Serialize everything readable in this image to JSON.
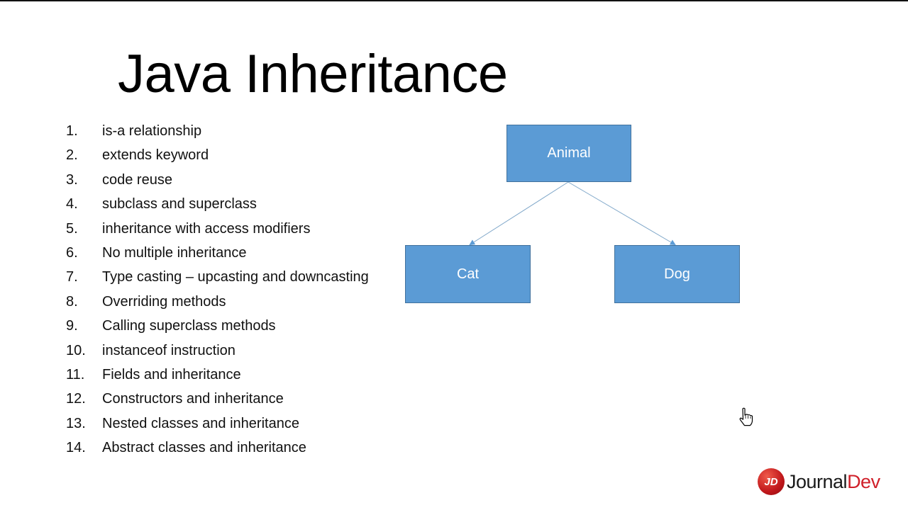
{
  "slide": {
    "title": "Java Inheritance",
    "topics": [
      {
        "num": "1.",
        "text": "is-a relationship"
      },
      {
        "num": "2.",
        "text": "extends keyword"
      },
      {
        "num": "3.",
        "text": "code reuse"
      },
      {
        "num": "4.",
        "text": "subclass and superclass"
      },
      {
        "num": "5.",
        "text": "inheritance with access modifiers"
      },
      {
        "num": "6.",
        "text": "No multiple inheritance"
      },
      {
        "num": "7.",
        "text": "Type casting – upcasting and downcasting"
      },
      {
        "num": "8.",
        "text": "Overriding methods"
      },
      {
        "num": "9.",
        "text": "Calling superclass methods"
      },
      {
        "num": "10.",
        "text": "instanceof instruction"
      },
      {
        "num": "11.",
        "text": "Fields and inheritance"
      },
      {
        "num": "12.",
        "text": "Constructors and inheritance"
      },
      {
        "num": "13.",
        "text": "Nested classes and inheritance"
      },
      {
        "num": "14.",
        "text": "Abstract classes and inheritance"
      }
    ]
  },
  "diagram": {
    "nodes": {
      "parent": "Animal",
      "child_left": "Cat",
      "child_right": "Dog"
    },
    "edges": [
      {
        "from": "Animal",
        "to": "Cat"
      },
      {
        "from": "Animal",
        "to": "Dog"
      }
    ],
    "colors": {
      "node_fill": "#5b9bd5",
      "node_border": "#41719c",
      "edge": "#7fa7c9"
    }
  },
  "branding": {
    "logo_mark": "JD",
    "logo_text_1": "Journal",
    "logo_text_2": "Dev",
    "brand_color": "#d0202a"
  },
  "cursor": {
    "icon": "hand-pointer-icon"
  }
}
